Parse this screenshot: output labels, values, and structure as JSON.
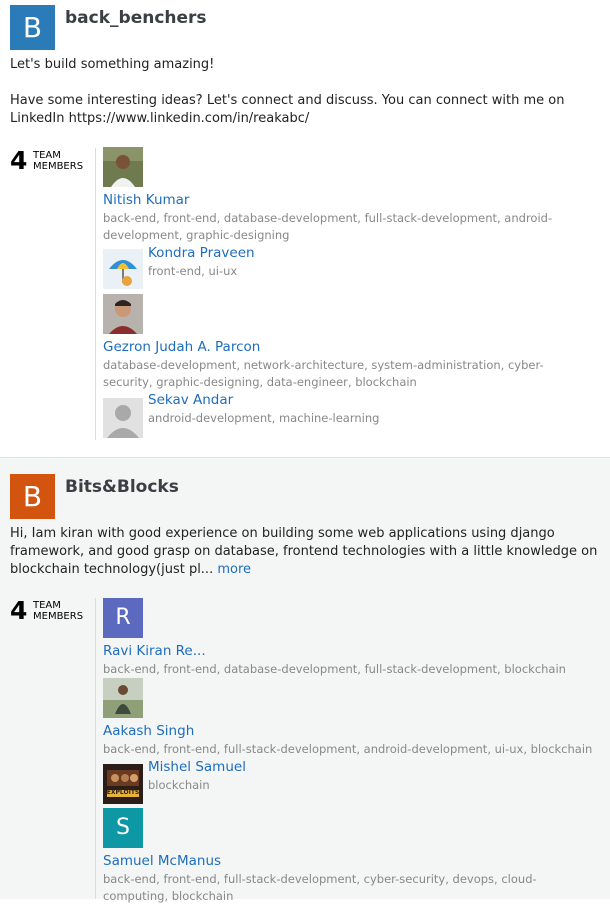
{
  "teams": [
    {
      "avatar_letter": "B",
      "avatar_color": "#2b7bb9",
      "name": "back_benchers",
      "description_line1": "Let's build something amazing!",
      "description_line2": "Have some interesting ideas? Let's connect and discuss. You can connect with me on LinkedIn https://www.linkedin.com/in/reakabc/",
      "member_count": "4",
      "member_label_1": "TEAM",
      "member_label_2": "MEMBERS",
      "members": [
        {
          "name": "Nitish Kumar",
          "skills": "back-end, front-end, database-development, full-stack-development, android-development, graphic-designing"
        },
        {
          "name": "Kondra Praveen",
          "skills": "front-end, ui-ux"
        },
        {
          "name": "Gezron Judah A. Parcon",
          "skills": "database-development, network-architecture, system-administration, cyber-security, graphic-designing, data-engineer, blockchain"
        },
        {
          "name": "Sekav Andar",
          "skills": "android-development, machine-learning"
        }
      ]
    },
    {
      "avatar_letter": "B",
      "avatar_color": "#d3540f",
      "name": "Bits&Blocks",
      "description": "Hi, Iam kiran with good experience on building some web applications using django framework, and good grasp on database, frontend technologies with a little knowledge on blockchain technology(just pl...",
      "more_label": "more",
      "member_count": "4",
      "member_label_1": "TEAM",
      "member_label_2": "MEMBERS",
      "members": [
        {
          "name": "Ravi Kiran Re...",
          "avatar_letter": "R",
          "avatar_color": "#5b6abf",
          "skills": "back-end, front-end, database-development, full-stack-development, blockchain"
        },
        {
          "name": "Aakash Singh",
          "skills": "back-end, front-end, full-stack-development, android-development, ui-ux, blockchain"
        },
        {
          "name": "Mishel Samuel",
          "photo_text": "EXPLOITS",
          "skills": "blockchain"
        },
        {
          "name": "Samuel McManus",
          "avatar_letter": "S",
          "avatar_color": "#0e97a4",
          "skills": "back-end, front-end, full-stack-development, cyber-security, devops, cloud-computing, blockchain"
        }
      ]
    }
  ]
}
